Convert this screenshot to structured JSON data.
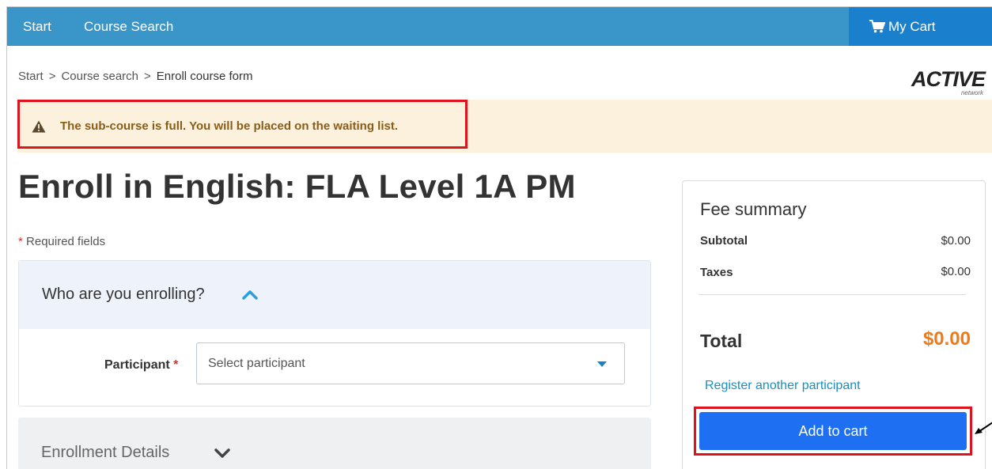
{
  "topnav": {
    "start_label": "Start",
    "course_search_label": "Course Search",
    "cart_label": "My Cart"
  },
  "breadcrumb": {
    "items": [
      "Start",
      "Course search",
      "Enroll course form"
    ],
    "separator": ">"
  },
  "logo": {
    "word": "ACTIVE",
    "sub": "network"
  },
  "alert": {
    "icon": "warning-icon",
    "message": "The sub-course is full. You will be placed on the waiting list."
  },
  "page": {
    "title": "Enroll in English: FLA Level 1A PM",
    "required_asterisk": "*",
    "required_note": "Required fields"
  },
  "enrolling": {
    "title": "Who are you enrolling?",
    "participant_label": "Participant",
    "participant_asterisk": "*",
    "participant_placeholder": "Select participant"
  },
  "details": {
    "title": "Enrollment Details"
  },
  "fee_summary": {
    "title": "Fee summary",
    "subtotal_label": "Subtotal",
    "subtotal_value": "$0.00",
    "taxes_label": "Taxes",
    "taxes_value": "$0.00",
    "total_label": "Total",
    "total_value": "$0.00",
    "register_link": "Register another participant",
    "add_to_cart": "Add to cart"
  },
  "colors": {
    "nav_bg": "#3a96c8",
    "cart_bg": "#1a7fcc",
    "highlight_border": "#e0121c",
    "total_orange": "#ef7a1a",
    "button_blue": "#1e6ff2",
    "link_blue": "#1a8fbf"
  }
}
